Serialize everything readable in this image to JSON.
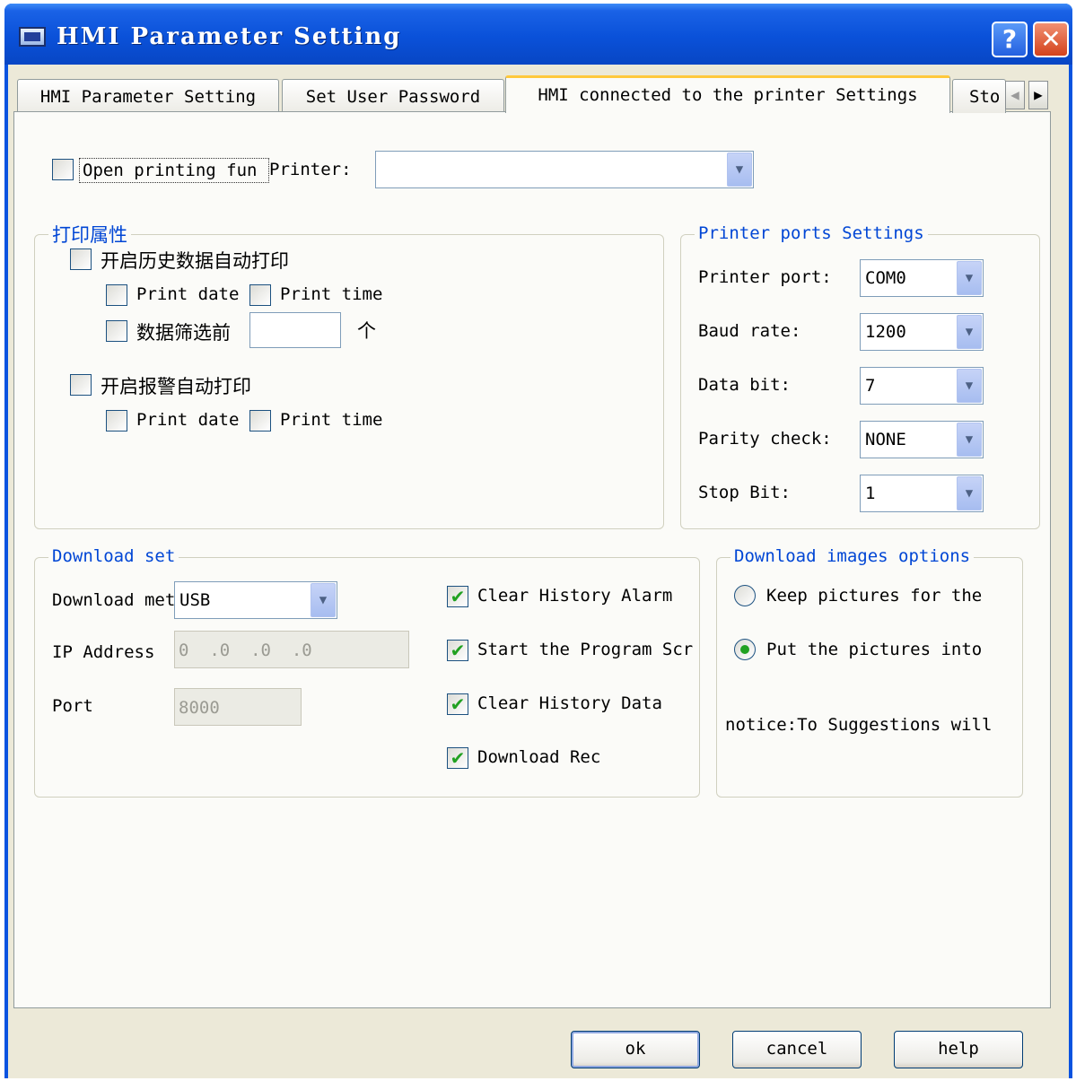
{
  "window": {
    "title": "HMI Parameter Setting",
    "help_glyph": "?",
    "close_glyph": "✕"
  },
  "tabs": [
    {
      "label": "HMI Parameter Setting",
      "active": false
    },
    {
      "label": "Set User Password",
      "active": false
    },
    {
      "label": "HMI connected to the printer Settings",
      "active": true
    },
    {
      "label": "Sto",
      "active": false
    }
  ],
  "tab_scroll": {
    "left": "◀",
    "right": "▶"
  },
  "open_printing": {
    "label": "Open printing fun",
    "checked": false
  },
  "printer": {
    "label": "Printer:",
    "value": ""
  },
  "print_props": {
    "legend": "打印属性",
    "history_auto_print": {
      "label": "开启历史数据自动打印",
      "checked": false
    },
    "history_print_date": {
      "label": "Print date",
      "checked": false
    },
    "history_print_time": {
      "label": "Print time",
      "checked": false
    },
    "filter": {
      "label": "数据筛选前",
      "value": "",
      "unit": "个",
      "checked": false
    },
    "alarm_auto_print": {
      "label": "开启报警自动打印",
      "checked": false
    },
    "alarm_print_date": {
      "label": "Print date",
      "checked": false
    },
    "alarm_print_time": {
      "label": "Print time",
      "checked": false
    }
  },
  "ports": {
    "legend": "Printer ports Settings",
    "printer_port": {
      "label": "Printer port:",
      "value": "COM0"
    },
    "baud_rate": {
      "label": "Baud rate:",
      "value": "1200"
    },
    "data_bit": {
      "label": "Data bit:",
      "value": "7"
    },
    "parity_check": {
      "label": "Parity check:",
      "value": "NONE"
    },
    "stop_bit": {
      "label": "Stop Bit:",
      "value": "1"
    }
  },
  "download": {
    "legend": "Download set",
    "method": {
      "label": "Download met",
      "value": "USB"
    },
    "ip": {
      "label": "IP Address",
      "value": "0  .0  .0  .0"
    },
    "port": {
      "label": "Port",
      "value": "8000"
    },
    "clear_alarm": {
      "label": "Clear History Alarm",
      "checked": true
    },
    "start_program": {
      "label": "Start the Program Scr",
      "checked": true
    },
    "clear_data": {
      "label": "Clear History Data",
      "checked": true
    },
    "download_rec": {
      "label": "Download Rec",
      "checked": true
    }
  },
  "images": {
    "legend": "Download images options",
    "keep": {
      "label": "Keep pictures for the",
      "selected": false
    },
    "put": {
      "label": "Put the pictures into",
      "selected": true
    },
    "notice": "notice:To Suggestions will"
  },
  "buttons": {
    "ok": "ok",
    "cancel": "cancel",
    "help": "help"
  },
  "colors": {
    "accent": "#0046d5",
    "title_bar": "#0a51d9",
    "check": "#21a121",
    "face": "#ece9d8"
  },
  "icons": {
    "dropdown": "▼",
    "check": "✔"
  }
}
